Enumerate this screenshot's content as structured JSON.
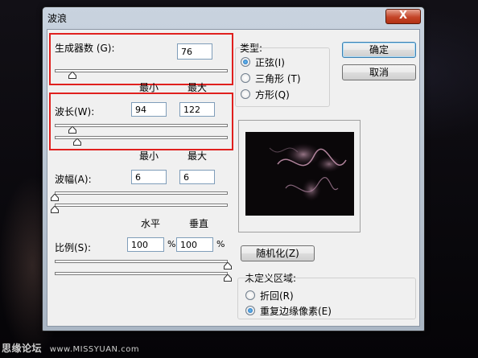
{
  "dialog": {
    "title": "波浪",
    "close_glyph": "X"
  },
  "generators": {
    "label": "生成器数 (G):",
    "value": "76",
    "slider_pct": 0.1
  },
  "col_headers_1": {
    "min": "最小",
    "max": "最大"
  },
  "wavelength": {
    "label": "波长(W):",
    "min": "94",
    "max": "122",
    "min_slider_pct": 0.1,
    "max_slider_pct": 0.13
  },
  "col_headers_2": {
    "min": "最小",
    "max": "最大"
  },
  "amplitude": {
    "label": "波幅(A):",
    "min": "6",
    "max": "6",
    "min_slider_pct": 0.0,
    "max_slider_pct": 0.0
  },
  "col_headers_3": {
    "horizontal": "水平",
    "vertical": "垂直"
  },
  "scale": {
    "label": "比例(S):",
    "horizontal": "100",
    "vertical": "100",
    "unit": "%",
    "h_slider_pct": 1.0,
    "v_slider_pct": 1.0
  },
  "type_group": {
    "title": "类型:",
    "options": [
      {
        "label": "正弦(I)",
        "selected": true
      },
      {
        "label": "三角形 (T)",
        "selected": false
      },
      {
        "label": "方形(Q)",
        "selected": false
      }
    ]
  },
  "buttons": {
    "ok": "确定",
    "cancel": "取消",
    "randomize": "随机化(Z)"
  },
  "undefined_area": {
    "title": "未定义区域:",
    "options": [
      {
        "label": "折回(R)",
        "selected": false
      },
      {
        "label": "重复边缘像素(E)",
        "selected": true
      }
    ]
  },
  "watermark": {
    "cn": "思缘论坛",
    "url": "www.MISSYUAN.com"
  },
  "colors": {
    "highlight": "#e0201e",
    "close": "#c44428"
  },
  "icons": {
    "close": "close-icon",
    "slider_thumb": "slider-thumb-icon"
  }
}
